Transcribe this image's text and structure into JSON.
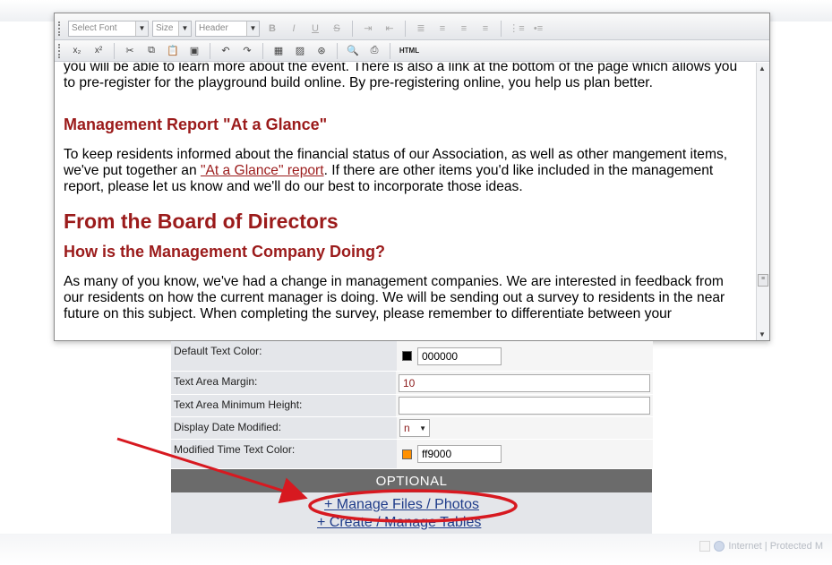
{
  "toolbar": {
    "font_select": "Select Font",
    "size_select": "Size",
    "header_select": "Header",
    "html_button": "HTML"
  },
  "content": {
    "para_intro": "you will be able to learn more about the event. There is also a link at the bottom of the page which allows you to pre-register for the playground build online. By pre-registering online, you help us plan better.",
    "heading_report": "Management Report \"At a Glance\"",
    "para_report_before": "To keep residents informed about the financial status of our Association, as well as other mangement items, we've put together an ",
    "report_link": "\"At a Glance\" report",
    "para_report_after": ". If there are other items you'd like included in the management report, please let us know and we'll do our best to incorporate those ideas.",
    "heading_board": "From the Board of Directors",
    "heading_company": "How is the Management Company Doing?",
    "para_company": "As many of you know, we've had a change in management companies. We are interested in feedback from our residents on how the current manager is doing. We will be sending out a survey to residents in the near future on this subject. When completing the survey, please remember to differentiate between your"
  },
  "settings": {
    "default_text_color_label": "Default Text Color:",
    "default_text_color_value": "000000",
    "default_text_color_swatch": "#000000",
    "text_area_margin_label": "Text Area Margin:",
    "text_area_margin_value": "10",
    "text_area_min_height_label": "Text Area Minimum Height:",
    "text_area_min_height_value": "",
    "display_date_modified_label": "Display Date Modified:",
    "display_date_modified_value": "n",
    "modified_time_color_label": "Modified Time Text Color:",
    "modified_time_color_value": "ff9000",
    "modified_time_color_swatch": "#ff9000"
  },
  "optional": {
    "header": "OPTIONAL",
    "manage_files_link": "+ Manage Files / Photos",
    "create_tables_link": "+ Create / Manage Tables"
  },
  "status": {
    "zone_text": "Internet | Protected M"
  },
  "colors": {
    "heading": "#9b1b1b",
    "link": "#1f3c8a",
    "annotation": "#d71920"
  }
}
